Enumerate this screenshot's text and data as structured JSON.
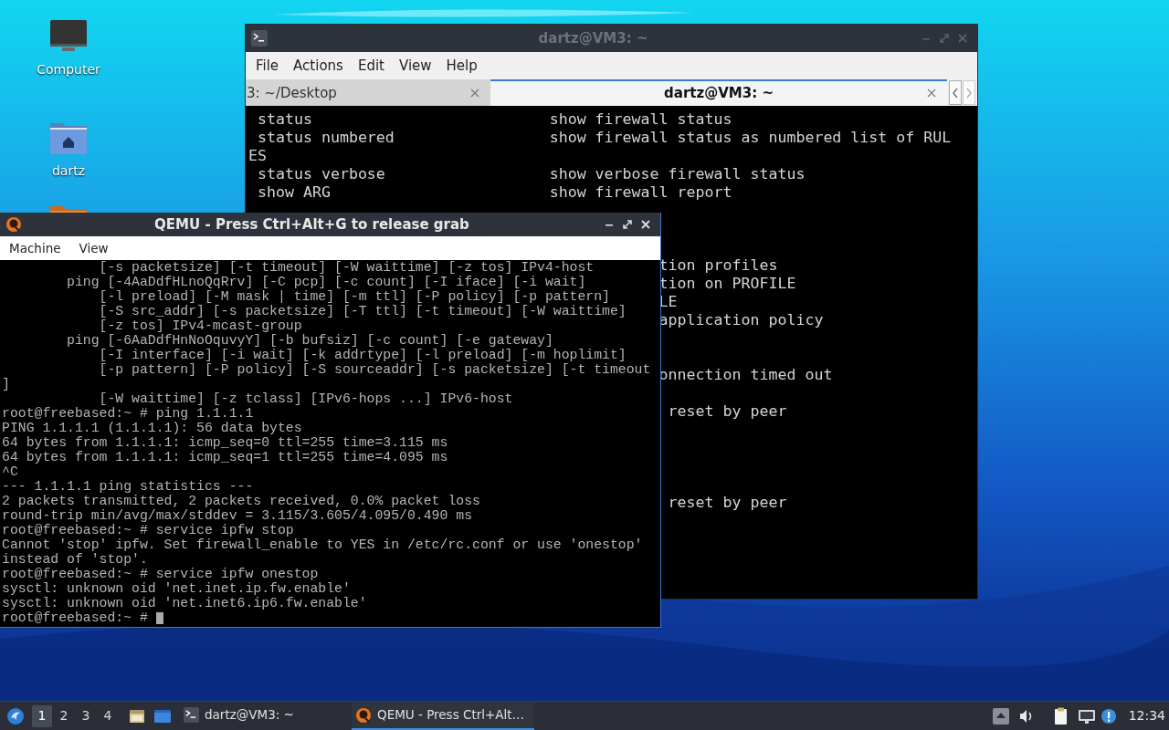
{
  "desktop": {
    "icons": [
      {
        "label": "Computer",
        "kind": "computer"
      },
      {
        "label": "dartz",
        "kind": "home"
      },
      {
        "kind": "folder"
      }
    ]
  },
  "terminal_window": {
    "title": "dartz@VM3: ~",
    "active": false,
    "menu": [
      "File",
      "Actions",
      "Edit",
      "View",
      "Help"
    ],
    "tabs": [
      {
        "label": "3: ~/Desktop",
        "selected": false
      },
      {
        "label": "dartz@VM3: ~",
        "selected": true
      }
    ],
    "output": " status                          show firewall status\n status numbered                 show firewall status as numbered list of RUL\nES\n status verbose                  show verbose firewall status\n show ARG                        show firewall report\n\n\n\n                                             tion profiles\n                                             tion on PROFILE\n                                             LE\n                                             application policy\n\n\n                                             onnection timed out\n\n                                              reset by peer\n\n\n\n\n                                              reset by peer"
  },
  "qemu_window": {
    "title": "QEMU - Press Ctrl+Alt+G to release grab",
    "active": true,
    "menu": [
      "Machine",
      "View"
    ],
    "cursor": true,
    "lines": [
      "            [-s packetsize] [-t timeout] [-W waittime] [-z tos] IPv4-host",
      "        ping [-4AaDdfHLnoQqRrv] [-C pcp] [-c count] [-I iface] [-i wait]",
      "            [-l preload] [-M mask | time] [-m ttl] [-P policy] [-p pattern]",
      "            [-S src_addr] [-s packetsize] [-T ttl] [-t timeout] [-W waittime]",
      "            [-z tos] IPv4-mcast-group",
      "        ping [-6AaDdfHnNoOquvyY] [-b bufsiz] [-c count] [-e gateway]",
      "            [-I interface] [-i wait] [-k addrtype] [-l preload] [-m hoplimit]",
      "            [-p pattern] [-P policy] [-S sourceaddr] [-s packetsize] [-t timeout",
      "]",
      "            [-W waittime] [-z tclass] [IPv6-hops ...] IPv6-host",
      "root@freebased:~ # ping 1.1.1.1",
      "PING 1.1.1.1 (1.1.1.1): 56 data bytes",
      "64 bytes from 1.1.1.1: icmp_seq=0 ttl=255 time=3.115 ms",
      "64 bytes from 1.1.1.1: icmp_seq=1 ttl=255 time=4.095 ms",
      "^C",
      "--- 1.1.1.1 ping statistics ---",
      "2 packets transmitted, 2 packets received, 0.0% packet loss",
      "round-trip min/avg/max/stddev = 3.115/3.605/4.095/0.490 ms",
      "root@freebased:~ # service ipfw stop",
      "Cannot 'stop' ipfw. Set firewall_enable to YES in /etc/rc.conf or use 'onestop'",
      "instead of 'stop'.",
      "root@freebased:~ # service ipfw onestop",
      "sysctl: unknown oid 'net.inet.ip.fw.enable'",
      "sysctl: unknown oid 'net.inet6.ip6.fw.enable'",
      "root@freebased:~ # "
    ]
  },
  "taskbar": {
    "workspaces": [
      {
        "label": "1",
        "selected": true
      },
      {
        "label": "2",
        "selected": false
      },
      {
        "label": "3",
        "selected": false
      },
      {
        "label": "4",
        "selected": false
      }
    ],
    "tasks": [
      {
        "label": "dartz@VM3: ~",
        "kind": "terminal",
        "selected": false
      },
      {
        "label": "QEMU - Press Ctrl+Alt…",
        "kind": "qemu",
        "selected": true
      }
    ],
    "clock": "12:34"
  }
}
